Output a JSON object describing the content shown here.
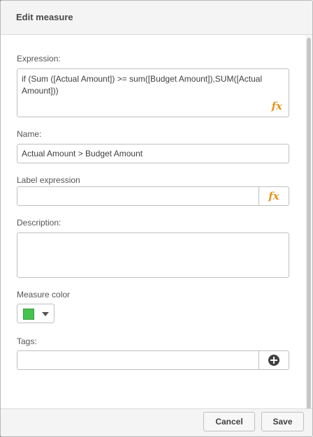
{
  "dialog": {
    "title": "Edit measure"
  },
  "expression": {
    "label": "Expression:",
    "value": "if (Sum ([Actual Amount]) >= sum([Budget Amount]),SUM([Actual Amount]))",
    "fx_label": "fx"
  },
  "name": {
    "label": "Name:",
    "value": "Actual Amount > Budget Amount"
  },
  "label_expression": {
    "label": "Label expression",
    "value": "",
    "fx_label": "fx"
  },
  "description": {
    "label": "Description:",
    "value": ""
  },
  "measure_color": {
    "label": "Measure color",
    "color": "#46c34f"
  },
  "tags": {
    "label": "Tags:",
    "value": ""
  },
  "footer": {
    "cancel_label": "Cancel",
    "save_label": "Save"
  },
  "colors": {
    "accent_fx": "#e5941e",
    "header_bg": "#f4f4f4",
    "border": "#bfbfbf"
  },
  "icons": {
    "expression_function": "fx-icon",
    "label_function": "fx-icon",
    "color_dropdown": "caret-down-icon",
    "add_tag": "plus-circle-icon"
  }
}
